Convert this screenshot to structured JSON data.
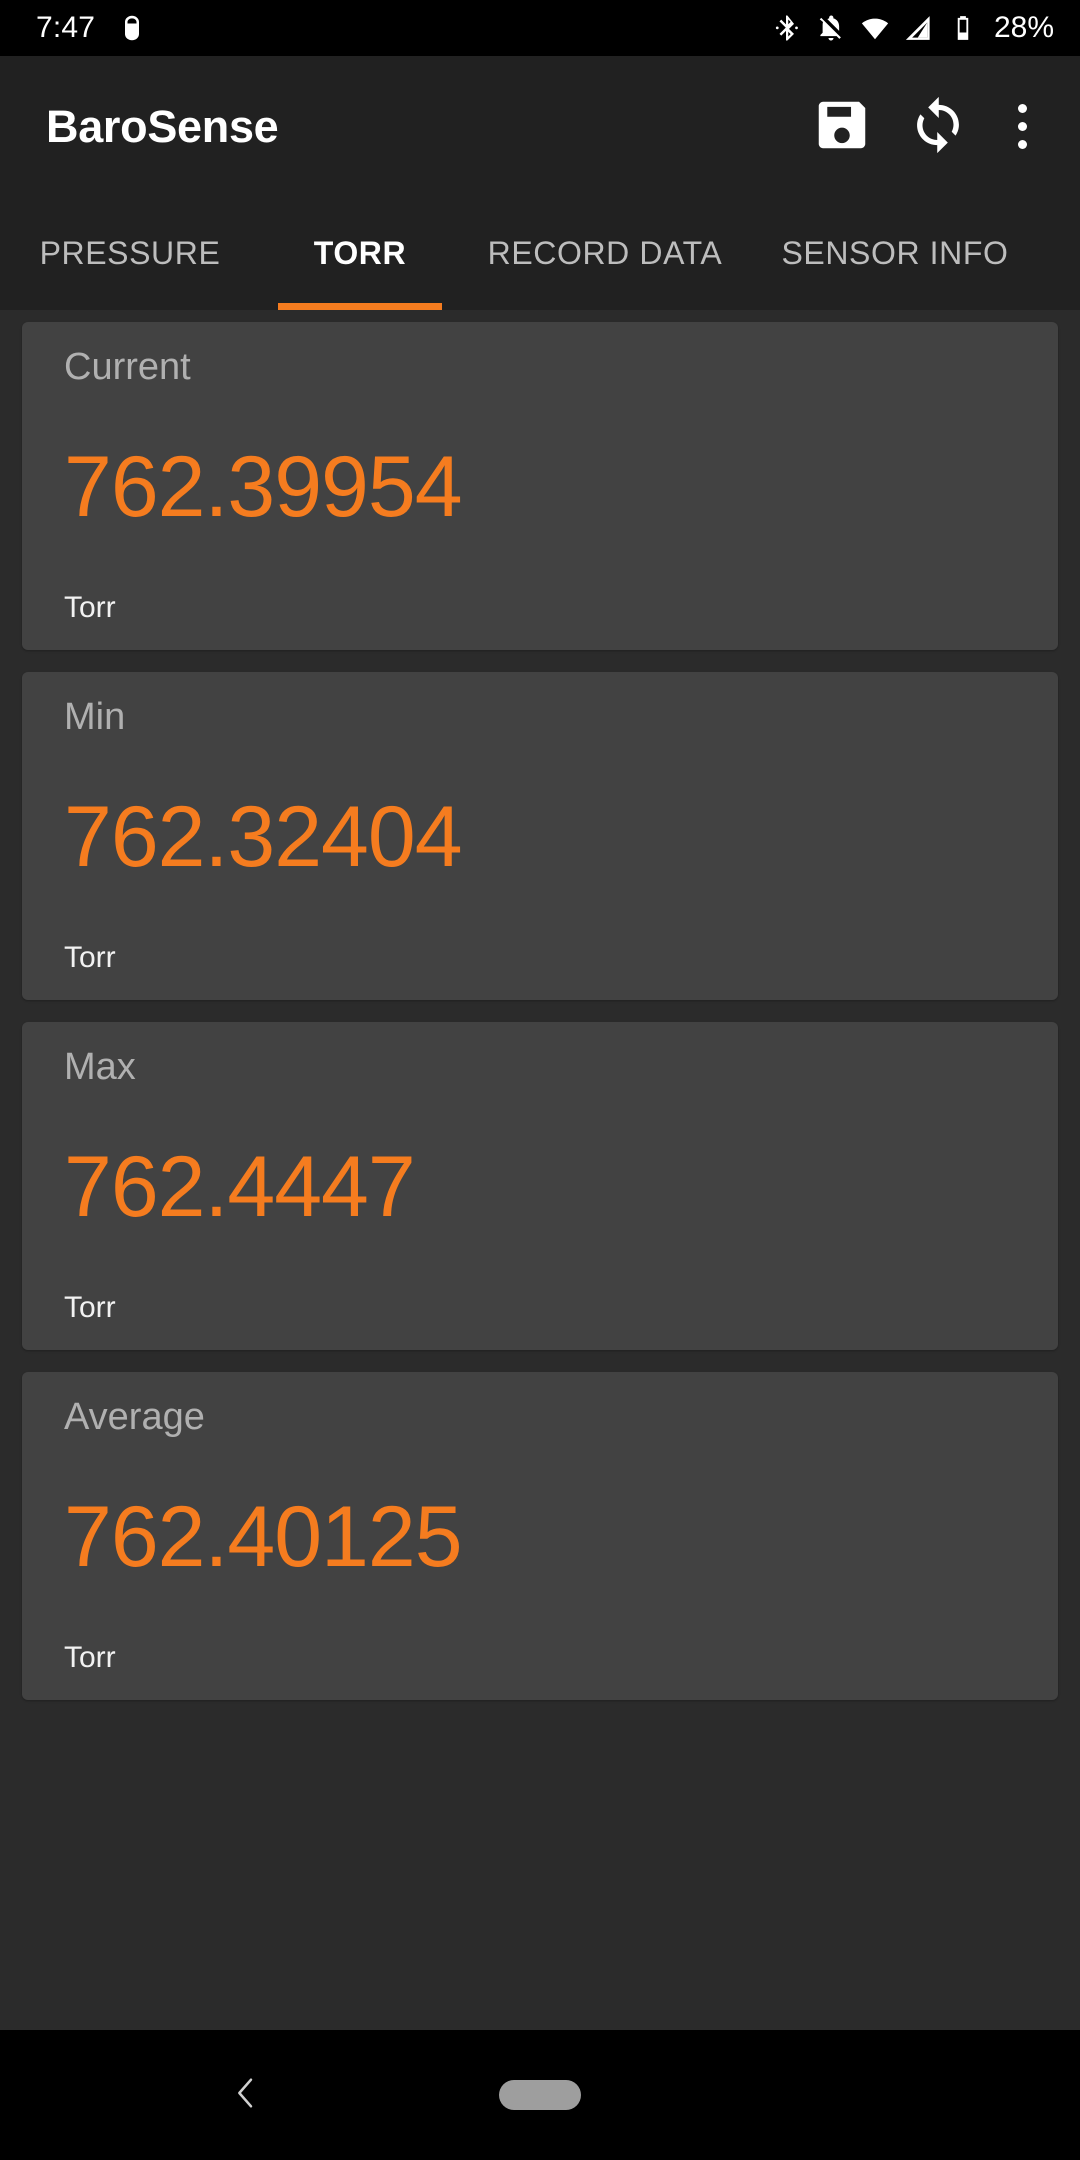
{
  "status_bar": {
    "clock": "7:47",
    "battery_percent": "28%",
    "icons": [
      "android-debug-icon",
      "bluetooth-icon",
      "notifications-off-icon",
      "wifi-icon",
      "cellular-signal-icon",
      "battery-icon"
    ]
  },
  "app_bar": {
    "title": "BaroSense",
    "actions": [
      {
        "name": "save-button",
        "icon": "save-floppy-icon"
      },
      {
        "name": "refresh-button",
        "icon": "refresh-sync-icon"
      },
      {
        "name": "overflow-menu-button",
        "icon": "more-vertical-icon"
      }
    ]
  },
  "tabs": {
    "active_index": 1,
    "items": [
      {
        "label": "PRESSURE"
      },
      {
        "label": "TORR"
      },
      {
        "label": "RECORD DATA"
      },
      {
        "label": "SENSOR INFO"
      }
    ]
  },
  "readings": [
    {
      "label": "Current",
      "value": "762.39954",
      "unit": "Torr"
    },
    {
      "label": "Min",
      "value": "762.32404",
      "unit": "Torr"
    },
    {
      "label": "Max",
      "value": "762.4447",
      "unit": "Torr"
    },
    {
      "label": "Average",
      "value": "762.40125",
      "unit": "Torr"
    }
  ],
  "nav_bar": {
    "back": "back-chevron-icon",
    "home": "home-pill-icon"
  },
  "colors": {
    "accent": "#f57c1f",
    "card_bg": "#424242",
    "app_bar_bg": "#212121",
    "content_bg": "#2b2b2b",
    "status_bg": "#000000",
    "label_text": "#b0b0b0",
    "unit_text": "#f2f2f2"
  }
}
